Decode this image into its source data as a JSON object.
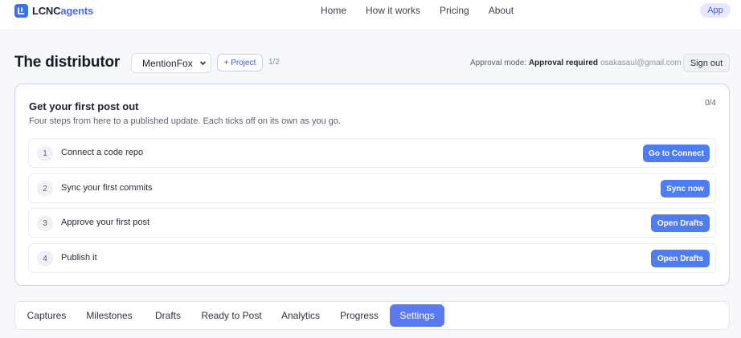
{
  "brand": {
    "name_prefix": "LCNC",
    "name_suffix": "agents"
  },
  "nav": {
    "links": [
      "Home",
      "How it works",
      "Pricing",
      "About"
    ],
    "app_label": "App"
  },
  "header": {
    "title": "The distributor",
    "project_select": {
      "value": "MentionFox"
    },
    "add_project_label": "+ Project",
    "project_count": "1/2",
    "approval_label": "Approval mode:",
    "approval_value": "Approval required",
    "email": "osakasaul@gmail.com",
    "signout_label": "Sign out"
  },
  "onboarding": {
    "title": "Get your first post out",
    "subtitle": "Four steps from here to a published update. Each ticks off on its own as you go.",
    "progress": "0/4",
    "steps": [
      {
        "num": "1",
        "label": "Connect a code repo",
        "action": "Go to Connect"
      },
      {
        "num": "2",
        "label": "Sync your first commits",
        "action": "Sync now"
      },
      {
        "num": "3",
        "label": "Approve your first post",
        "action": "Open Drafts"
      },
      {
        "num": "4",
        "label": "Publish it",
        "action": "Open Drafts"
      }
    ]
  },
  "tabs": {
    "items": [
      "Captures",
      "Milestones",
      "Drafts",
      "Ready to Post",
      "Analytics",
      "Progress",
      "Settings"
    ],
    "active": "Settings"
  },
  "colors": {
    "accent": "#4f7cf0",
    "brand": "#3b6ff5",
    "active_tab": "#5b79f1"
  }
}
